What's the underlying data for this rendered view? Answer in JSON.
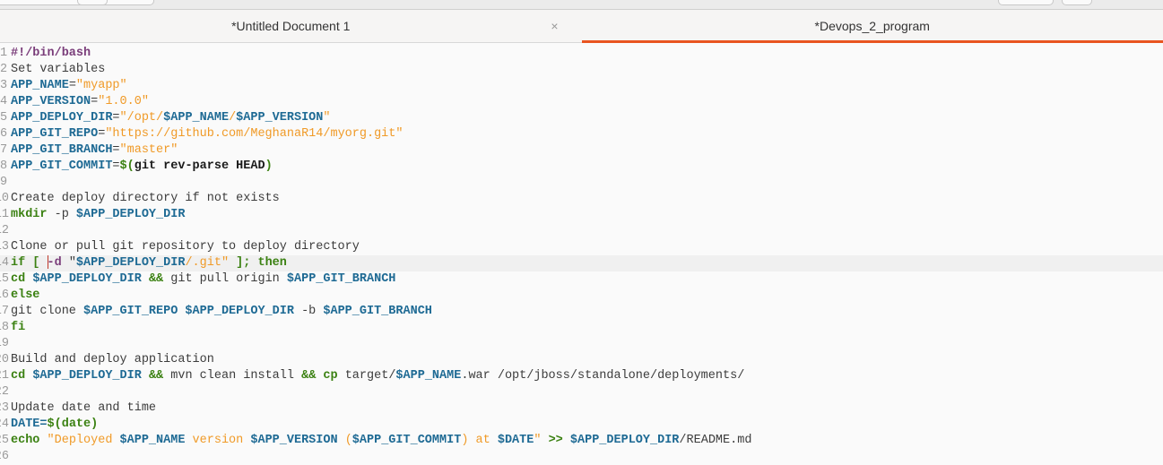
{
  "tabs": [
    {
      "label": "*Untitled Document 1",
      "active": false,
      "close_icon": "×"
    },
    {
      "label": "*Devops_2_program",
      "active": true
    }
  ],
  "editor": {
    "current_line": 14,
    "lines": [
      [
        [
          "p",
          "#!/bin/bash"
        ]
      ],
      [
        [
          "t",
          "Set variables"
        ]
      ],
      [
        [
          "v",
          "APP_NAME"
        ],
        [
          "t",
          "="
        ],
        [
          "s",
          "\"myapp\""
        ]
      ],
      [
        [
          "v",
          "APP_VERSION"
        ],
        [
          "t",
          "="
        ],
        [
          "s",
          "\"1.0.0\""
        ]
      ],
      [
        [
          "v",
          "APP_DEPLOY_DIR"
        ],
        [
          "t",
          "="
        ],
        [
          "s",
          "\"/opt/"
        ],
        [
          "v",
          "$APP_NAME"
        ],
        [
          "s",
          "/"
        ],
        [
          "v",
          "$APP_VERSION"
        ],
        [
          "s",
          "\""
        ]
      ],
      [
        [
          "v",
          "APP_GIT_REPO"
        ],
        [
          "t",
          "="
        ],
        [
          "s",
          "\"https://github.com/MeghanaR14/myorg.git\""
        ]
      ],
      [
        [
          "v",
          "APP_GIT_BRANCH"
        ],
        [
          "t",
          "="
        ],
        [
          "s",
          "\"master\""
        ]
      ],
      [
        [
          "v",
          "APP_GIT_COMMIT"
        ],
        [
          "t",
          "="
        ],
        [
          "k",
          "$("
        ],
        [
          "b",
          "git rev-parse HEAD"
        ],
        [
          "k",
          ")"
        ]
      ],
      [],
      [
        [
          "t",
          "Create deploy directory if not exists"
        ]
      ],
      [
        [
          "k",
          "mkdir"
        ],
        [
          "t",
          " -p "
        ],
        [
          "v",
          "$APP_DEPLOY_DIR"
        ]
      ],
      [],
      [
        [
          "t",
          "Clone or pull git repository to deploy directory"
        ]
      ],
      [
        [
          "k",
          "if [ "
        ],
        [
          "caret",
          ""
        ],
        [
          "p",
          "-d"
        ],
        [
          "t",
          " \""
        ],
        [
          "v",
          "$APP_DEPLOY_DIR"
        ],
        [
          "s",
          "/.git\""
        ],
        [
          "k",
          " ]; then"
        ]
      ],
      [
        [
          "k",
          "cd "
        ],
        [
          "v",
          "$APP_DEPLOY_DIR"
        ],
        [
          "k",
          " &&"
        ],
        [
          "t",
          " git pull origin "
        ],
        [
          "v",
          "$APP_GIT_BRANCH"
        ]
      ],
      [
        [
          "k",
          "else"
        ]
      ],
      [
        [
          "t",
          "git clone "
        ],
        [
          "v",
          "$APP_GIT_REPO $APP_DEPLOY_DIR"
        ],
        [
          "t",
          " -b "
        ],
        [
          "v",
          "$APP_GIT_BRANCH"
        ]
      ],
      [
        [
          "k",
          "fi"
        ]
      ],
      [],
      [
        [
          "t",
          "Build and deploy application"
        ]
      ],
      [
        [
          "k",
          "cd "
        ],
        [
          "v",
          "$APP_DEPLOY_DIR"
        ],
        [
          "k",
          " &&"
        ],
        [
          "t",
          " mvn clean install "
        ],
        [
          "k",
          "&& cp"
        ],
        [
          "t",
          " target/"
        ],
        [
          "v",
          "$APP_NAME"
        ],
        [
          "t",
          ".war /opt/jboss/standalone/deployments/"
        ]
      ],
      [],
      [
        [
          "t",
          "Update date and time"
        ]
      ],
      [
        [
          "v",
          "DATE="
        ],
        [
          "k",
          "$(date)"
        ]
      ],
      [
        [
          "k",
          "echo"
        ],
        [
          "t",
          " "
        ],
        [
          "s",
          "\"Deployed "
        ],
        [
          "v",
          "$APP_NAME"
        ],
        [
          "s",
          " version "
        ],
        [
          "v",
          "$APP_VERSION"
        ],
        [
          "s",
          " ("
        ],
        [
          "v",
          "$APP_GIT_COMMIT"
        ],
        [
          "s",
          ") at "
        ],
        [
          "v",
          "$DATE"
        ],
        [
          "s",
          "\""
        ],
        [
          "k",
          " >>"
        ],
        [
          "t",
          " "
        ],
        [
          "v",
          "$APP_DEPLOY_DIR"
        ],
        [
          "t",
          "/README.md"
        ]
      ],
      []
    ]
  }
}
